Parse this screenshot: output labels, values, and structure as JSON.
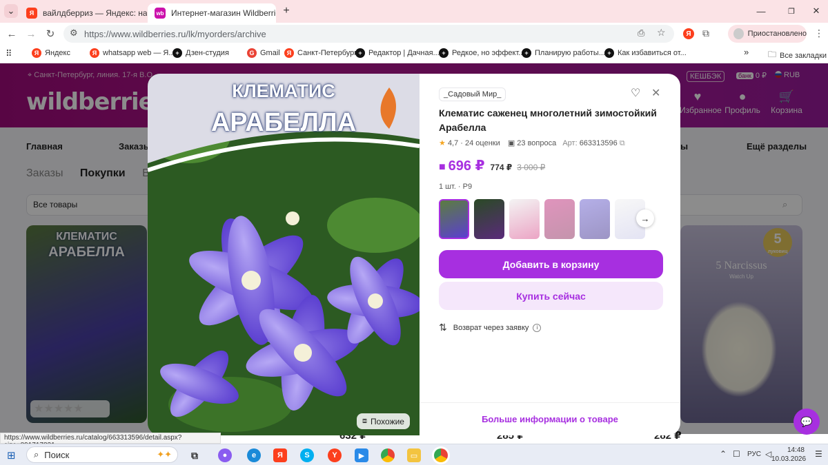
{
  "browser": {
    "tabs": [
      {
        "title": "вайлдберриз — Яндекс: нашл",
        "icon": "Я"
      },
      {
        "title": "Интернет-магазин Wildberries",
        "icon": "wb"
      }
    ],
    "new_tab": "+",
    "url": "https://www.wildberries.ru/lk/myorders/archive",
    "profile_label": "Приостановлено",
    "bookmarks": [
      "Яндекс",
      "whatsapp web — Я...",
      "Дзен-студия",
      "Gmail",
      "Санкт-Петербург",
      "Редактор | Дачная...",
      "Редкое, но эффект...",
      "Планирую работы...",
      "Как избавиться от..."
    ],
    "all_bookmarks": "Все закладки",
    "more_bookmarks": "»"
  },
  "site": {
    "logo": "wildberries",
    "location": "Санкт-Петербург, линия. 17-я В.О.",
    "cashback": "КЕШБЭК",
    "bank": "банк",
    "balance": "0 ₽",
    "currency": "RUB",
    "favorites": "Избранное",
    "profile": "Профиль",
    "cart": "Корзина",
    "nav": {
      "home": "Главная",
      "orders": "Заказы",
      "more": "Ещё разделы",
      "partial": "ы"
    },
    "subtabs": {
      "orders": "Заказы",
      "purchases": "Покупки",
      "partial": "В"
    },
    "filter": "Все товары",
    "cards": [
      {
        "title": "КЛЕМАТИС",
        "subtitle": "АРАБЕЛЛА",
        "price": "632 ₽"
      },
      {
        "price": "285 ₽"
      },
      {
        "price": "282 ₽",
        "badge": "5",
        "badge_sub": "луковиц",
        "caption": "5 Narcissus",
        "caption_sub": "Watch Up"
      }
    ]
  },
  "modal": {
    "photo_title_1": "КЛЕМАТИС",
    "photo_title_2": "АРАБЕЛЛА",
    "similar": "Похожие",
    "brand": "_Садовый Мир_",
    "title": "Клематис саженец многолетний зимостойкий Арабелла",
    "rating": "4,7",
    "reviews": "24 оценки",
    "questions": "23 вопроса",
    "article_label": "Арт:",
    "article": "663313596",
    "price": "696 ₽",
    "old_price_1": "774 ₽",
    "old_price_2": "3 000 ₽",
    "pack": "1 шт. · Р9",
    "add_to_cart": "Добавить в корзину",
    "buy_now": "Купить сейчас",
    "return": "Возврат через заявку",
    "more_info": "Больше информации о товаре"
  },
  "status_url": "https://www.wildberries.ru/catalog/663313596/detail.aspx?size=891717831",
  "taskbar": {
    "search": "Поиск",
    "lang": "РУС",
    "time": "14:48",
    "date": "10.03.2026"
  },
  "colors": {
    "accent": "#a72fe0",
    "brand": "#a10a7d"
  }
}
